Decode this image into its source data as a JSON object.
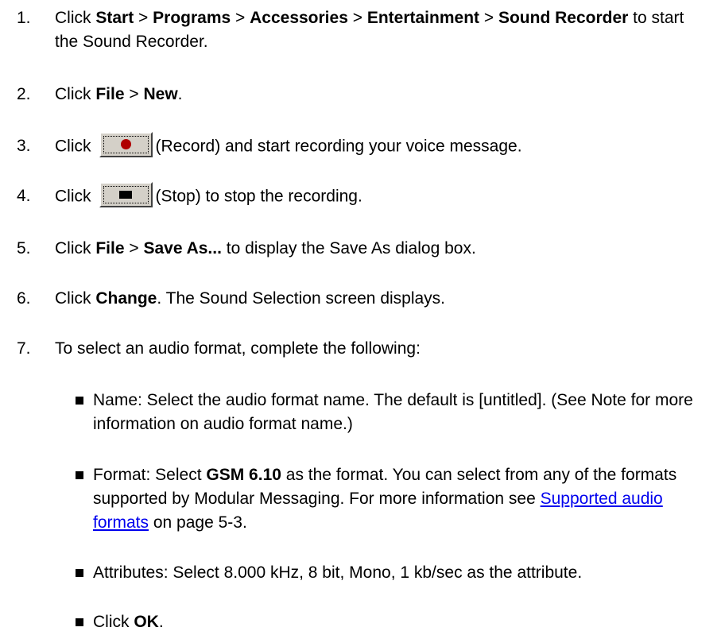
{
  "steps": [
    {
      "num": "1.",
      "p1": "Click ",
      "b1": "Start",
      "p2": " > ",
      "b2": "Programs",
      "p3": " > ",
      "b3": "Accessories",
      "p4": " > ",
      "b4": "Entertainment",
      "p5": " > ",
      "b5": "Sound Recorder",
      "p6": " to start the Sound Recorder."
    },
    {
      "num": "2.",
      "p1": "Click ",
      "b1": "File",
      "p2": " > ",
      "b2": "New",
      "p3": "."
    },
    {
      "num": "3.",
      "p1": "Click",
      "p2": "(Record) and start recording your voice message."
    },
    {
      "num": "4.",
      "p1": "Click",
      "p2": "(Stop) to stop the recording."
    },
    {
      "num": "5.",
      "p1": "Click ",
      "b1": "File",
      "p2": " > ",
      "b2": "Save As...",
      "p3": " to display the Save As dialog box."
    },
    {
      "num": "6.",
      "p1": "Click ",
      "b1": "Change",
      "p2": ". The Sound Selection screen displays."
    },
    {
      "num": "7.",
      "p1": "To select an audio format, complete the following:"
    }
  ],
  "bullets": [
    {
      "text": "Name: Select the audio format name. The default is [untitled]. (See Note for more information on audio format name.)"
    },
    {
      "p1": "Format: Select ",
      "b1": "GSM 6.10",
      "p2": " as the format. You can select from any of the formats supported by Modular Messaging. For more information see ",
      "link": "Supported audio formats",
      "p3": " on page 5-3."
    },
    {
      "text": "Attributes: Select 8.000 kHz, 8 bit, Mono, 1 kb/sec as the attribute."
    },
    {
      "p1": "Click ",
      "b1": "OK",
      "p2": "."
    }
  ],
  "icons": {
    "record": "record-button-icon",
    "stop": "stop-button-icon"
  },
  "colors": {
    "record_dot": "#b00000",
    "link": "#0000ee",
    "button_face": "#d4d0c8"
  }
}
